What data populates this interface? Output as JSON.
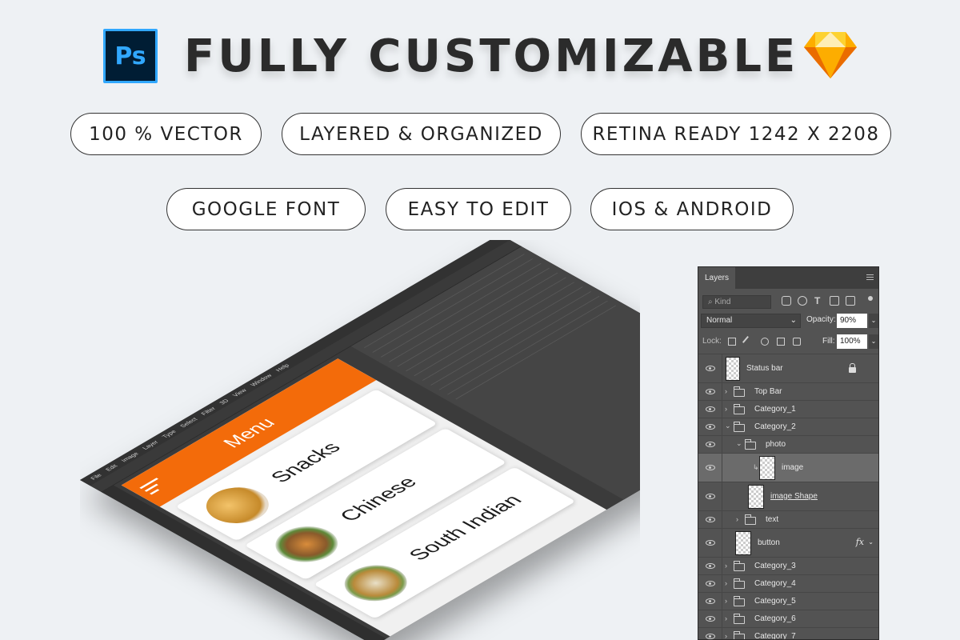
{
  "header": {
    "ps_logo": "Ps",
    "title": "FULLY CUSTOMIZABLE",
    "sketch_icon": "sketch-diamond-icon",
    "colors": {
      "ps_bg": "#001d34",
      "ps_accent": "#31a8ff",
      "sketch": "#fdb300"
    }
  },
  "features": [
    "100 % VECTOR",
    "LAYERED & ORGANIZED",
    "RETINA READY 1242 X 2208",
    "GOOGLE FONT",
    "EASY TO EDIT",
    "IOS & ANDROID"
  ],
  "mockup": {
    "menubar": [
      "File",
      "Edit",
      "Image",
      "Layer",
      "Type",
      "Select",
      "Filter",
      "3D",
      "View",
      "Window",
      "Help"
    ],
    "app_title": "Menu",
    "accent": "#f36b0a",
    "categories": [
      "Snacks",
      "Chinese",
      "South Indian"
    ]
  },
  "layers_panel": {
    "tab": "Layers",
    "kind_placeholder": "Kind",
    "blend_mode": "Normal",
    "opacity_label": "Opacity:",
    "opacity_value": "90%",
    "lock_label": "Lock:",
    "fill_label": "Fill:",
    "fill_value": "100%",
    "layers": [
      {
        "name": "Status bar",
        "kind": "layer",
        "locked": true
      },
      {
        "name": "Top Bar",
        "kind": "group"
      },
      {
        "name": "Category_1",
        "kind": "group"
      },
      {
        "name": "Category_2",
        "kind": "group-open"
      },
      {
        "name": "photo",
        "kind": "group-open-nested"
      },
      {
        "name": "image",
        "kind": "clipped-layer",
        "selected": true
      },
      {
        "name": "image Shape",
        "kind": "shape"
      },
      {
        "name": "text",
        "kind": "group-nested"
      },
      {
        "name": "button",
        "kind": "layer-fx",
        "fx": "fx"
      },
      {
        "name": "Category_3",
        "kind": "group"
      },
      {
        "name": "Category_4",
        "kind": "group"
      },
      {
        "name": "Category_5",
        "kind": "group"
      },
      {
        "name": "Category_6",
        "kind": "group"
      },
      {
        "name": "Category_7",
        "kind": "group"
      }
    ]
  }
}
